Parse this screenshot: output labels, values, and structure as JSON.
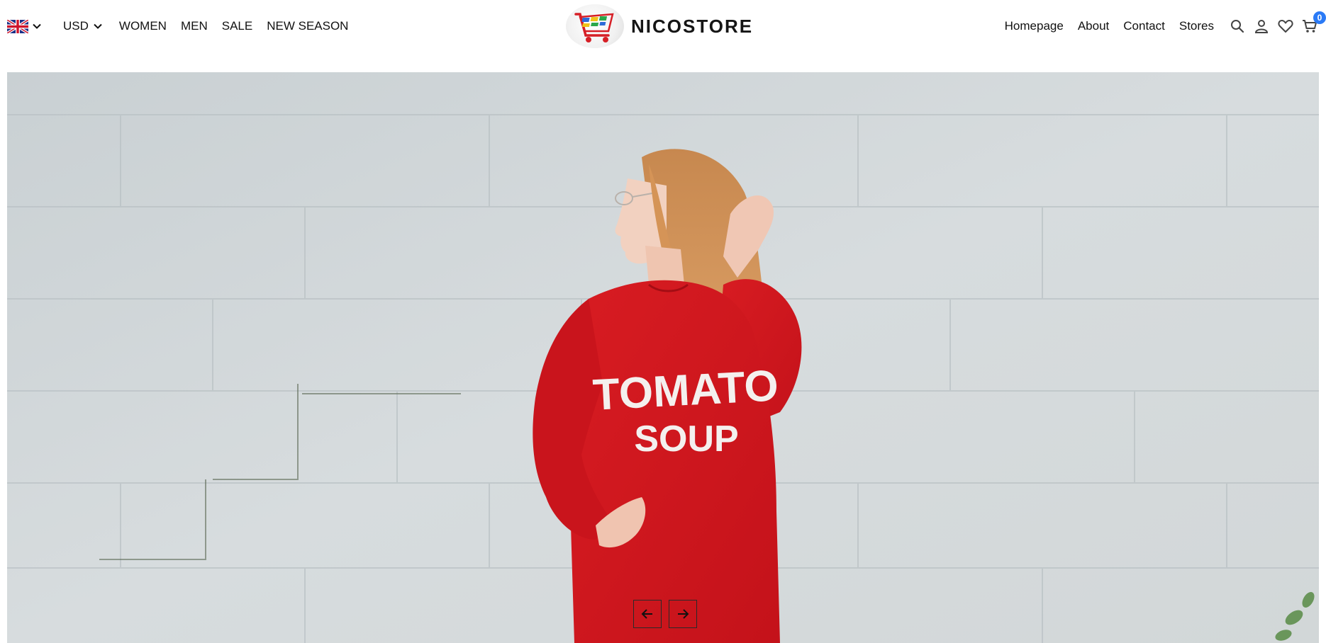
{
  "locale": {
    "flag_icon": "uk-flag-icon",
    "currency": "USD"
  },
  "nav_left": [
    {
      "label": "WOMEN"
    },
    {
      "label": "MEN"
    },
    {
      "label": "SALE"
    },
    {
      "label": "NEW SEASON"
    }
  ],
  "brand": {
    "name": "NICOSTORE",
    "logo_icon": "shopping-cart-logo"
  },
  "nav_right": [
    {
      "label": "Homepage"
    },
    {
      "label": "About"
    },
    {
      "label": "Contact"
    },
    {
      "label": "Stores"
    }
  ],
  "icons": {
    "search": "search-icon",
    "account": "user-icon",
    "wishlist": "heart-icon",
    "cart": "cart-icon"
  },
  "cart": {
    "count": "0",
    "badge_color": "#2a7af6"
  },
  "hero": {
    "sweatshirt_text_line1": "TOMATO",
    "sweatshirt_text_line2": "SOUP",
    "sweatshirt_color": "#d41820",
    "wall_color": "#cfd4d6"
  }
}
